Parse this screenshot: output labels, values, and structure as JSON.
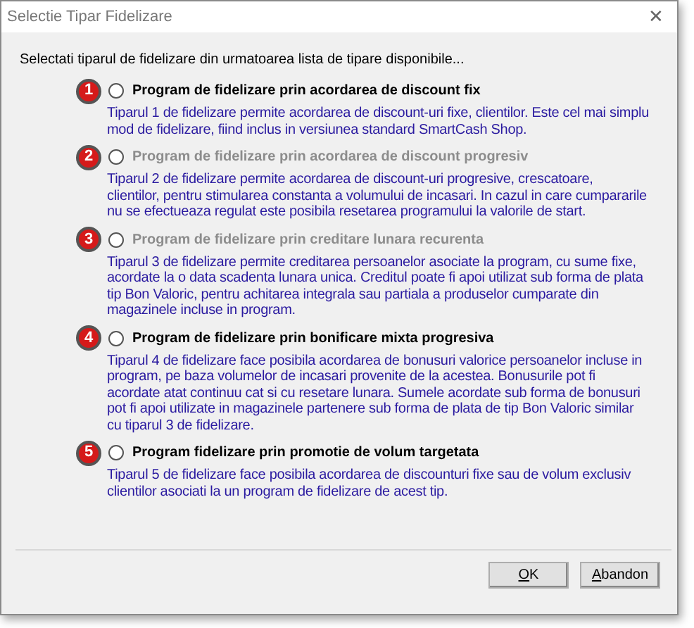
{
  "window": {
    "title": "Selectie Tipar Fidelizare",
    "close": "✕"
  },
  "intro": "Selectati tiparul de fidelizare din urmatoarea lista de tipare disponibile...",
  "options": [
    {
      "number": "1",
      "title": "Program de fidelizare prin acordarea de discount fix",
      "description": "Tiparul 1 de fidelizare permite acordarea de discount-uri fixe, clientilor. Este cel mai simplu mod de fidelizare, fiind inclus in versiunea standard SmartCash Shop.",
      "disabled": false,
      "selected": false
    },
    {
      "number": "2",
      "title": "Program de fidelizare prin acordarea de discount progresiv",
      "description": "Tiparul 2 de fidelizare permite acordarea de discount-uri progresive, crescatoare, clientilor, pentru stimularea constanta a volumului de incasari. In cazul in care cumpararile nu se efectueaza regulat este posibila resetarea programului la valorile de start.",
      "disabled": true,
      "selected": false
    },
    {
      "number": "3",
      "title": "Program de fidelizare prin creditare lunara recurenta",
      "description": "Tiparul 3 de fidelizare permite creditarea persoanelor asociate la program, cu sume fixe, acordate la o data scadenta lunara unica. Creditul poate fi apoi utilizat sub forma de plata tip Bon Valoric, pentru achitarea integrala sau partiala a produselor cumparate din magazinele incluse in program.",
      "disabled": true,
      "selected": false
    },
    {
      "number": "4",
      "title": "Program de fidelizare prin bonificare mixta progresiva",
      "description": "Tiparul 4 de fidelizare face posibila acordarea de bonusuri valorice persoanelor incluse in program, pe baza volumelor de incasari provenite de la acestea. Bonusurile pot fi acordate atat continuu cat si cu resetare lunara. Sumele acordate sub forma de bonusuri pot fi apoi utilizate in magazinele partenere sub forma de plata de tip Bon Valoric similar cu tiparul 3 de fidelizare.",
      "disabled": false,
      "selected": false
    },
    {
      "number": "5",
      "title": "Program fidelizare prin promotie de volum targetata",
      "description": "Tiparul 5 de fidelizare face posibila acordarea de discounturi fixe sau de volum exclusiv clientilor asociati la un program de fidelizare de acest tip.",
      "disabled": false,
      "selected": false
    }
  ],
  "buttons": [
    {
      "access_key": "O",
      "label_rest": "K"
    },
    {
      "access_key": "A",
      "label_rest": "bandon"
    }
  ]
}
